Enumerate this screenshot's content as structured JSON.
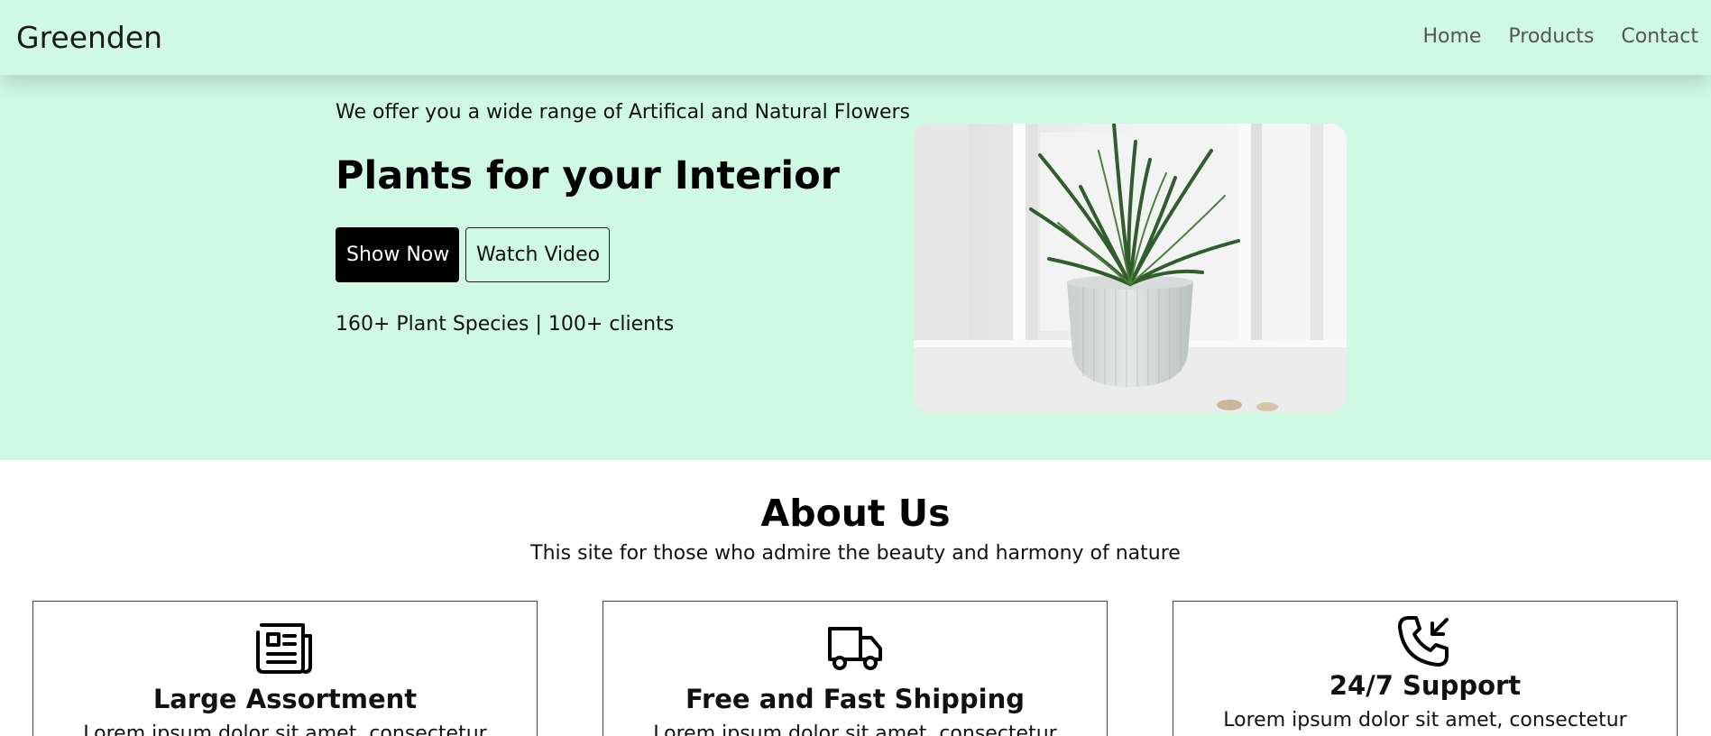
{
  "nav": {
    "brand": "Greenden",
    "links": [
      "Home",
      "Products",
      "Contact"
    ]
  },
  "hero": {
    "tagline": "We offer you a wide range of Artifical and Natural Flowers",
    "headline": "Plants for your Interior",
    "primary_button": "Show Now",
    "secondary_button": "Watch Video",
    "stats": "160+ Plant Species | 100+ clients"
  },
  "about": {
    "title": "About Us",
    "subtitle": "This site for those who admire the beauty and harmony of nature",
    "cards": [
      {
        "icon": "newspaper-icon",
        "title": "Large Assortment",
        "text": "Lorem ipsum dolor sit amet, consectetur"
      },
      {
        "icon": "truck-icon",
        "title": "Free and Fast Shipping",
        "text": "Lorem ipsum dolor sit amet, consectetur"
      },
      {
        "icon": "phone-incoming-icon",
        "title": "24/7 Support",
        "text": "Lorem ipsum dolor sit amet, consectetur"
      }
    ]
  },
  "colors": {
    "hero_background": "#cff9e3",
    "primary_button": "#000000",
    "text": "#111111"
  }
}
